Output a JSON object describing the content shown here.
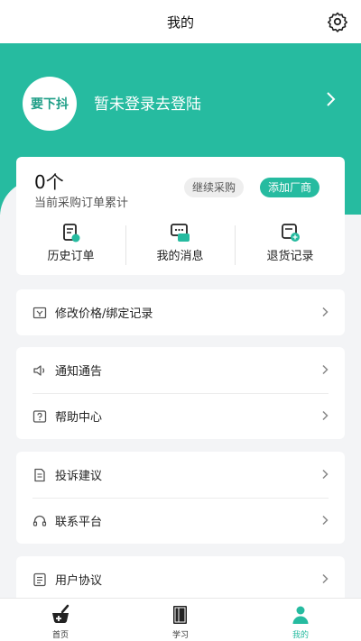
{
  "header": {
    "title": "我的"
  },
  "profile": {
    "logo_text": "要下抖",
    "login_prompt": "暂未登录去登陆"
  },
  "stats": {
    "count": "0个",
    "count_label": "当前采购订单累计",
    "continue_purchase": "继续采购",
    "add_vendor": "添加厂商",
    "quick": [
      {
        "label": "历史订单",
        "icon": "order-history-icon"
      },
      {
        "label": "我的消息",
        "icon": "message-icon"
      },
      {
        "label": "退货记录",
        "icon": "return-record-icon"
      }
    ]
  },
  "menu": {
    "price_binding": "修改价格/绑定记录",
    "notice": "通知通告",
    "help": "帮助中心",
    "complaint": "投诉建议",
    "contact": "联系平台",
    "agreement": "用户协议"
  },
  "tabbar": {
    "home": "首页",
    "learn": "学习",
    "mine": "我的"
  },
  "colors": {
    "accent": "#26bba0",
    "background": "#f3f4f6"
  }
}
